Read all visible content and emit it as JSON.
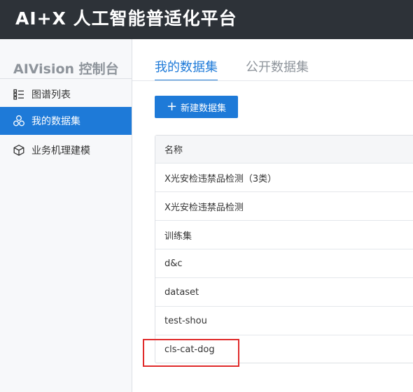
{
  "header": {
    "brand": "AI+X 人工智能普适化平台"
  },
  "sidebar": {
    "title": "AIVision 控制台",
    "items": [
      {
        "label": "图谱列表",
        "icon": "list-icon",
        "active": false
      },
      {
        "label": "我的数据集",
        "icon": "cluster-icon",
        "active": true
      },
      {
        "label": "业务机理建模",
        "icon": "cube-icon",
        "active": false
      }
    ]
  },
  "main": {
    "tabs": [
      {
        "label": "我的数据集",
        "active": true
      },
      {
        "label": "公开数据集",
        "active": false
      }
    ],
    "new_button": {
      "icon": "plus-icon",
      "label": "新建数据集"
    },
    "table": {
      "column_header": "名称",
      "rows": [
        "X光安检违禁品检测（3类）",
        "X光安检违禁品检测",
        "训练集",
        "d&c",
        "dataset",
        "test-shou",
        "cls-cat-dog"
      ]
    }
  },
  "colors": {
    "accent": "#1e7ad8",
    "topbar": "#2d3238",
    "highlight": "#e02a2a"
  }
}
